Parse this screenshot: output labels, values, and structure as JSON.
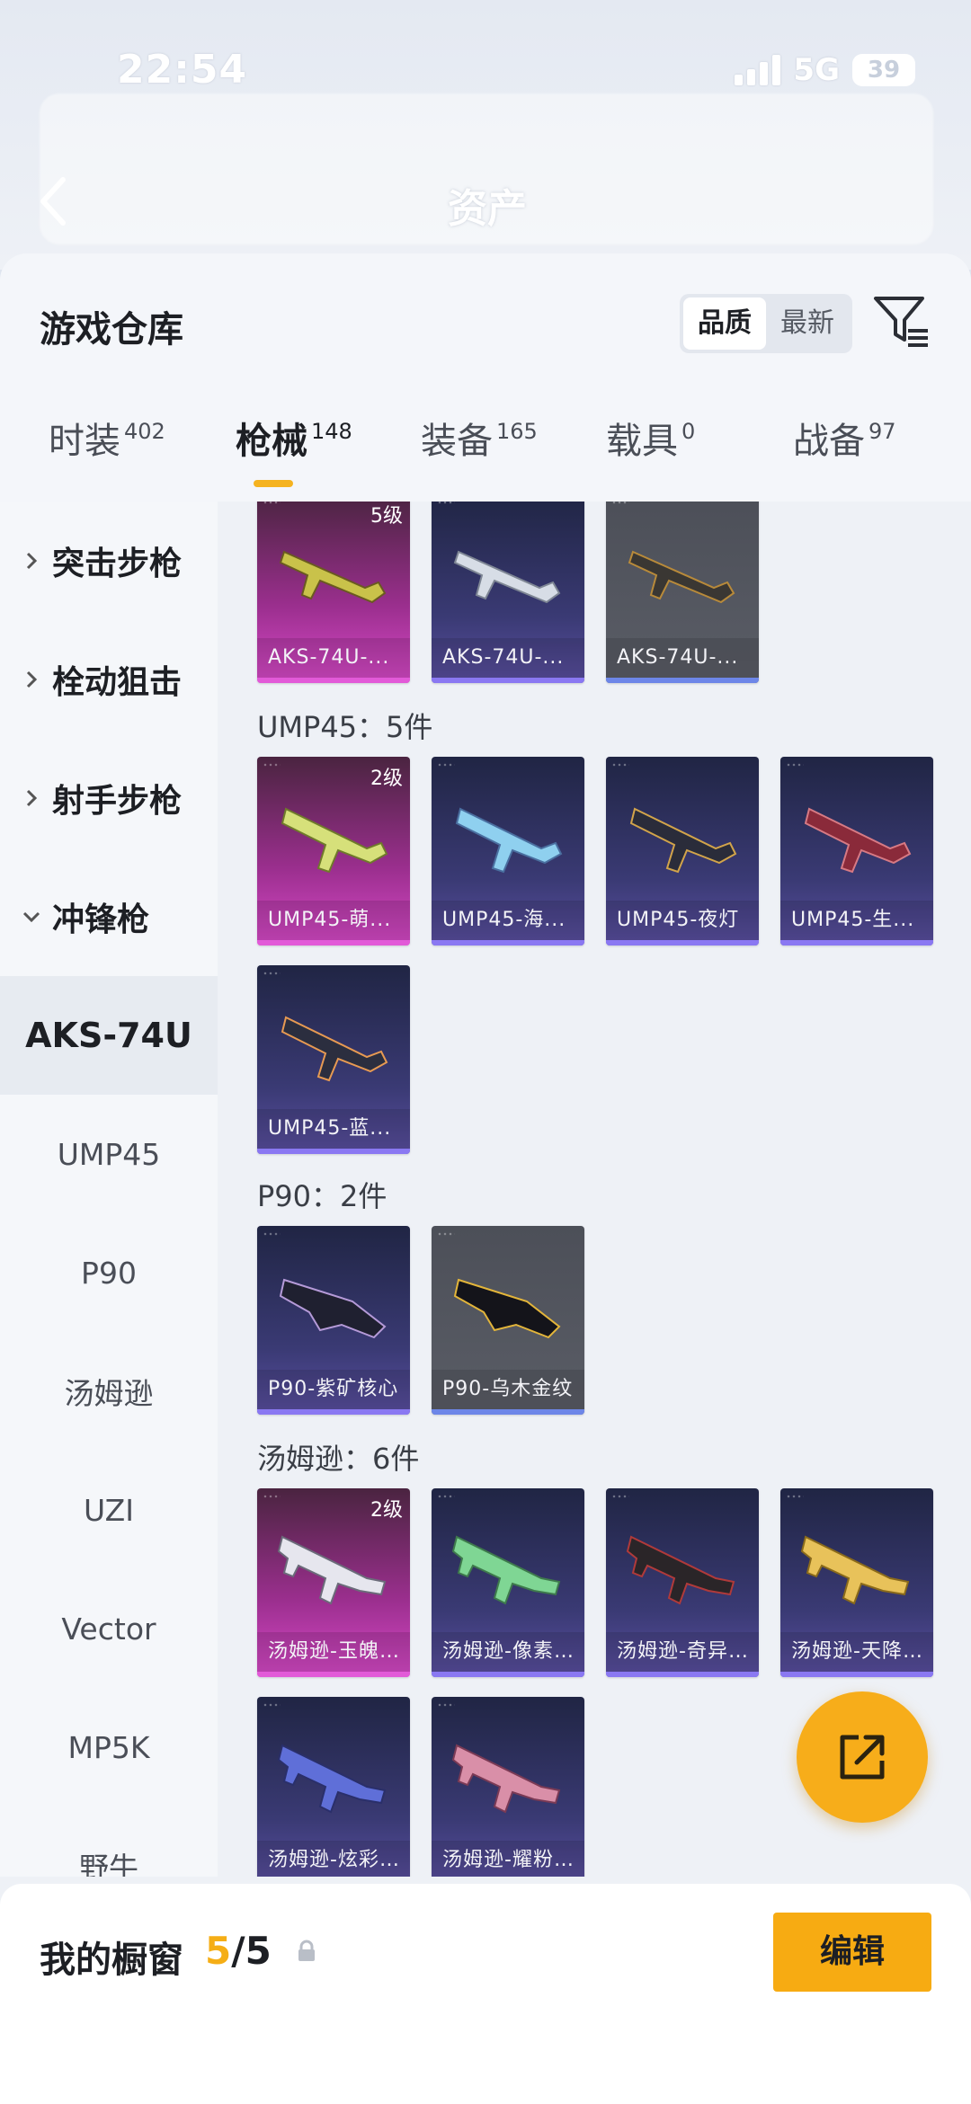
{
  "status_bar": {
    "time": "22:54",
    "network": "5G",
    "battery": "39"
  },
  "page": {
    "title": "资产"
  },
  "sheet": {
    "title": "游戏仓库",
    "sort": [
      {
        "label": "品质",
        "active": true
      },
      {
        "label": "最新",
        "active": false
      }
    ],
    "tabs": [
      {
        "label": "时装",
        "count": "402"
      },
      {
        "label": "枪械",
        "count": "148",
        "active": true
      },
      {
        "label": "装备",
        "count": "165"
      },
      {
        "label": "载具",
        "count": "0"
      },
      {
        "label": "战备",
        "count": "97"
      }
    ]
  },
  "sidebar": {
    "categories": [
      "突击步枪",
      "栓动狙击",
      "射手步枪",
      "冲锋枪"
    ],
    "subcategories": [
      "AKS-74U",
      "UMP45",
      "P90",
      "汤姆逊",
      "UZI",
      "Vector",
      "MP5K",
      "野牛"
    ],
    "active_sub": "AKS-74U"
  },
  "groups": [
    {
      "title": "",
      "items": [
        {
          "name": "AKS-74U-...",
          "rarity": "pink",
          "level": "5级"
        },
        {
          "name": "AKS-74U-...",
          "rarity": "purple"
        },
        {
          "name": "AKS-74U-...",
          "rarity": "gray"
        }
      ]
    },
    {
      "title": "UMP45：5件",
      "items": [
        {
          "name": "UMP45-萌...",
          "rarity": "pink",
          "level": "2级"
        },
        {
          "name": "UMP45-海...",
          "rarity": "purple"
        },
        {
          "name": "UMP45-夜灯",
          "rarity": "purple"
        },
        {
          "name": "UMP45-生...",
          "rarity": "purple"
        },
        {
          "name": "UMP45-蓝...",
          "rarity": "purple"
        }
      ]
    },
    {
      "title": "P90：2件",
      "items": [
        {
          "name": "P90-紫矿核心",
          "rarity": "purple"
        },
        {
          "name": "P90-乌木金纹",
          "rarity": "gray"
        }
      ]
    },
    {
      "title": "汤姆逊：6件",
      "items": [
        {
          "name": "汤姆逊-玉魄...",
          "rarity": "pink",
          "level": "2级"
        },
        {
          "name": "汤姆逊-像素...",
          "rarity": "purple"
        },
        {
          "name": "汤姆逊-奇异...",
          "rarity": "purple"
        },
        {
          "name": "汤姆逊-天降...",
          "rarity": "purple"
        },
        {
          "name": "汤姆逊-炫彩...",
          "rarity": "purple"
        },
        {
          "name": "汤姆逊-耀粉...",
          "rarity": "purple"
        }
      ]
    }
  ],
  "showcase": {
    "title": "我的橱窗",
    "used": "5",
    "total": "/5",
    "edit_label": "编辑"
  },
  "icons": {
    "back": "chevron-left-icon",
    "filter": "filter-icon",
    "share": "share-icon",
    "lock": "lock-icon"
  },
  "colors": {
    "accent": "#f7ab12",
    "rarity_pink": "#e25ad8",
    "rarity_purple": "#8a78f2",
    "rarity_gray": "#6d86e8"
  }
}
